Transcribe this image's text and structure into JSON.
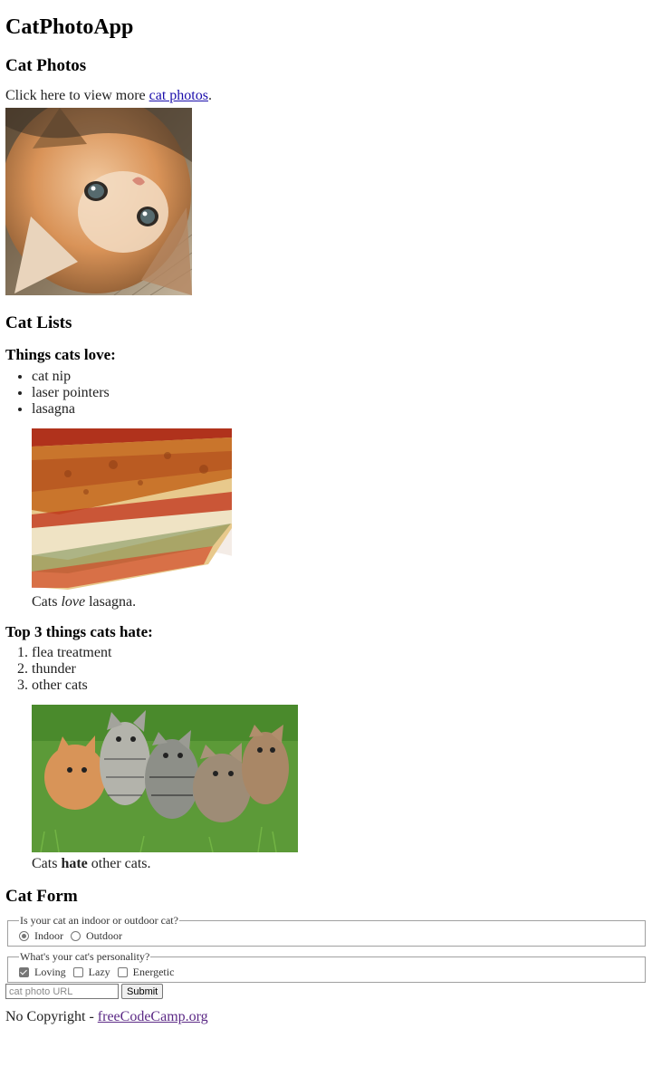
{
  "app_title": "CatPhotoApp",
  "cat_photos": {
    "heading": "Cat Photos",
    "intro_text": "Click here to view more ",
    "link_text": "cat photos",
    "intro_end": "."
  },
  "cat_lists": {
    "heading": "Cat Lists",
    "love": {
      "heading": "Things cats love:",
      "items": [
        "cat nip",
        "laser pointers",
        "lasagna"
      ],
      "caption_before": "Cats ",
      "caption_emphasis": "love",
      "caption_after": " lasagna."
    },
    "hate": {
      "heading": "Top 3 things cats hate:",
      "items": [
        "flea treatment",
        "thunder",
        "other cats"
      ],
      "caption_before": "Cats ",
      "caption_emphasis": "hate",
      "caption_after": " other cats."
    }
  },
  "cat_form": {
    "heading": "Cat Form",
    "location": {
      "legend": "Is your cat an indoor or outdoor cat?",
      "options": [
        "Indoor",
        "Outdoor"
      ],
      "selected": "Indoor"
    },
    "personality": {
      "legend": "What's your cat's personality?",
      "options": [
        "Loving",
        "Lazy",
        "Energetic"
      ],
      "checked": [
        "Loving"
      ]
    },
    "url_placeholder": "cat photo URL",
    "submit_label": "Submit"
  },
  "footer": {
    "text": "No Copyright - ",
    "link_text": "freeCodeCamp.org"
  }
}
